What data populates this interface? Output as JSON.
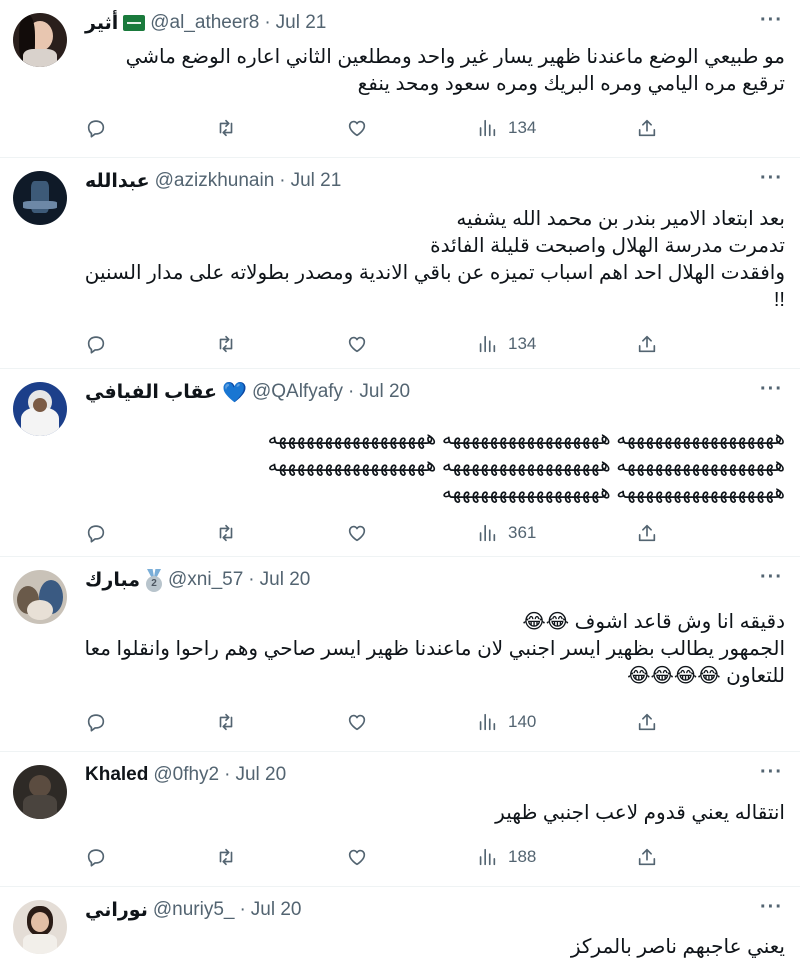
{
  "tweets": [
    {
      "name": "أثير",
      "handle": "@al_atheer8",
      "dot": "·",
      "date": "Jul 21",
      "badge": "saudi-flag",
      "lines": [
        "مو طبيعي الوضع ماعندنا ظهير يسار غير واحد ومطلعين الثاني اعاره الوضع ماشي",
        "ترقيع مره اليامي ومره البريك ومره سعود ومحد ينفع"
      ],
      "views": "134",
      "more": "···"
    },
    {
      "name": "عبدالله",
      "handle": "@azizkhunain",
      "dot": "·",
      "date": "Jul 21",
      "badge": "",
      "lines": [
        "بعد ابتعاد الامير بندر بن محمد الله يشفيه",
        "تدمرت مدرسة الهلال واصبحت قليلة الفائدة",
        "وافقدت الهلال احد اهم اسباب تميزه عن باقي الاندية ومصدر بطولاته على مدار السنين",
        "!!"
      ],
      "views": "134",
      "more": "···"
    },
    {
      "name": "عقاب الفيافي",
      "handle": "@QAlfyafy",
      "dot": "·",
      "date": "Jul 20",
      "badge": "blue-heart",
      "lines": [
        "هههههههههههههههههه هههههههههههههههههه هههههههههههههههههه",
        "هههههههههههههههههه هههههههههههههههههه هههههههههههههههههه",
        "هههههههههههههههههه هههههههههههههههههه"
      ],
      "views": "361",
      "more": "···"
    },
    {
      "name": "مبارك",
      "handle": "@xni_57",
      "dot": "·",
      "date": "Jul 20",
      "badge": "silver-medal",
      "lines": [
        "دقيقه انا وش قاعد اشوف 😂😂",
        "الجمهور يطالب بظهير ايسر اجنبي لان ماعندنا ظهير ايسر صاحي وهم راحوا وانقلوا معاذ",
        "للتعاون 😂😂😂😂"
      ],
      "views": "140",
      "more": "···"
    },
    {
      "name": "Khaled",
      "handle": "@0fhy2",
      "dot": "·",
      "date": "Jul 20",
      "badge": "",
      "lines": [
        "انتقاله يعني قدوم لاعب اجنبي ظهير"
      ],
      "views": "188",
      "more": "···"
    },
    {
      "name": "نوراني",
      "handle": "@nuriy5_",
      "dot": "·",
      "date": "Jul 20",
      "badge": "",
      "lines": [
        "يعني عاجبهم ناصر بالمركز"
      ],
      "views": "",
      "more": "···"
    }
  ],
  "icons": {
    "reply": "reply-icon",
    "retweet": "retweet-icon",
    "like": "heart-icon",
    "views": "views-icon",
    "share": "share-icon",
    "more": "more-icon"
  },
  "colors": {
    "text": "#0f1419",
    "secondary": "#536471",
    "divider": "#eff3f4",
    "badge_heart": "#6aa6e3"
  }
}
